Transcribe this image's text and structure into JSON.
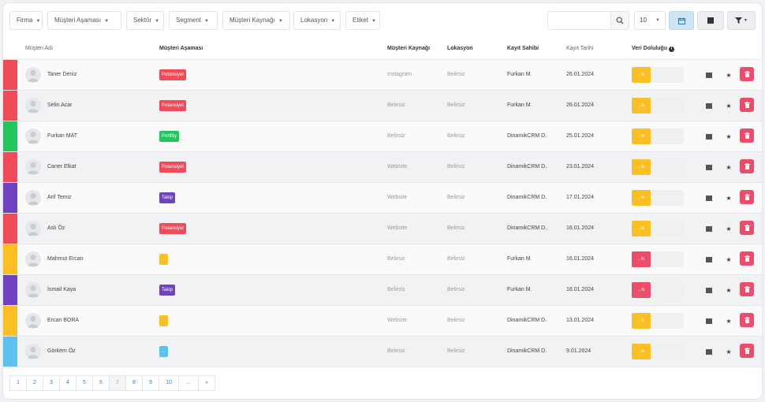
{
  "filters": [
    "Firma",
    "Müşteri Aşaması",
    "Sektör",
    "Segment",
    "Müşteri Kaynağı",
    "Lokasyon",
    "Etiket"
  ],
  "search": {
    "value": "",
    "placeholder": ""
  },
  "page_size": "10",
  "toolbar_icons": [
    "calendar-icon",
    "columns-icon",
    "filter-icon"
  ],
  "columns": {
    "name": "Müşteri Adı",
    "stage": "Müşteri Aşaması",
    "source": "Müşteri Kaynağı",
    "location": "Lokasyon",
    "owner": "Kayıt Sahibi",
    "date": "Kayıt Tarihi",
    "fill": "Veri Doluluğu"
  },
  "colors": {
    "red": "#ef4b59",
    "green": "#22c55e",
    "purple": "#6f42c1",
    "yellow": "#fbbf24",
    "blue": "#5ec1ec",
    "delete": "#ec4d6b"
  },
  "rows": [
    {
      "name": "Taner Deniz",
      "stage": "Potansiyel",
      "stage_color": "#ef4b59",
      "stripe": "#ef4b59",
      "source": "Instagram",
      "location": "Belirsiz",
      "owner": "Furkan M.",
      "date": "26.01.2024",
      "fill": "...%",
      "fill_color": "#fbbf24"
    },
    {
      "name": "Selin Acar",
      "stage": "Potansiyel",
      "stage_color": "#ef4b59",
      "stripe": "#ef4b59",
      "source": "Belirsiz",
      "location": "Belirsiz",
      "owner": "Furkan M.",
      "date": "26.01.2024",
      "fill": "...%",
      "fill_color": "#fbbf24"
    },
    {
      "name": "Furkan MAT",
      "stage": "Portföy",
      "stage_color": "#22c55e",
      "stripe": "#22c55e",
      "source": "Belirsiz",
      "location": "Belirsiz",
      "owner": "DinamikCRM D.",
      "date": "25.01.2024",
      "fill": "...%",
      "fill_color": "#fbbf24"
    },
    {
      "name": "Caner Elkat",
      "stage": "Potansiyel",
      "stage_color": "#ef4b59",
      "stripe": "#ef4b59",
      "source": "Website",
      "location": "Belirsiz",
      "owner": "DinamikCRM D.",
      "date": "23.01.2024",
      "fill": "...%",
      "fill_color": "#fbbf24"
    },
    {
      "name": "Arif Temiz",
      "stage": "Takip",
      "stage_color": "#6f42c1",
      "stripe": "#6f42c1",
      "source": "Website",
      "location": "Belirsiz",
      "owner": "DinamikCRM D.",
      "date": "17.01.2024",
      "fill": "...%",
      "fill_color": "#fbbf24"
    },
    {
      "name": "Aslı Öz",
      "stage": "Potansiyel",
      "stage_color": "#ef4b59",
      "stripe": "#ef4b59",
      "source": "Website",
      "location": "Belirsiz",
      "owner": "DinamikCRM D.",
      "date": "16.01.2024",
      "fill": "...%",
      "fill_color": "#fbbf24"
    },
    {
      "name": "Mahmut Ercan",
      "stage": "...",
      "stage_color": "#fbbf24",
      "stripe": "#fbbf24",
      "source": "Belirsiz",
      "location": "Belirsiz",
      "owner": "Furkan M.",
      "date": "16.01.2024",
      "fill": "...%",
      "fill_color": "#ec4d6b"
    },
    {
      "name": "İsmail Kaya",
      "stage": "Takip",
      "stage_color": "#6f42c1",
      "stripe": "#6f42c1",
      "source": "Belirsiz",
      "location": "Belirsiz",
      "owner": "Furkan M.",
      "date": "16.01.2024",
      "fill": "...%",
      "fill_color": "#ec4d6b"
    },
    {
      "name": "Ercan BORA",
      "stage": "...",
      "stage_color": "#fbbf24",
      "stripe": "#fbbf24",
      "source": "Website",
      "location": "Belirsiz",
      "owner": "DinamikCRM D.",
      "date": "13.01.2024",
      "fill": "...%",
      "fill_color": "#fbbf24"
    },
    {
      "name": "Görkem Öz",
      "stage": "...",
      "stage_color": "#5ec1ec",
      "stripe": "#5ec1ec",
      "source": "Belirsiz",
      "location": "Belirsiz",
      "owner": "DinamikCRM D.",
      "date": "9.01.2024",
      "fill": "...%",
      "fill_color": "#fbbf24"
    }
  ],
  "pagination": [
    "1",
    "2",
    "3",
    "4",
    "5",
    "6",
    "7",
    "8",
    "9",
    "10",
    "...",
    "»"
  ],
  "pagination_active": "7"
}
